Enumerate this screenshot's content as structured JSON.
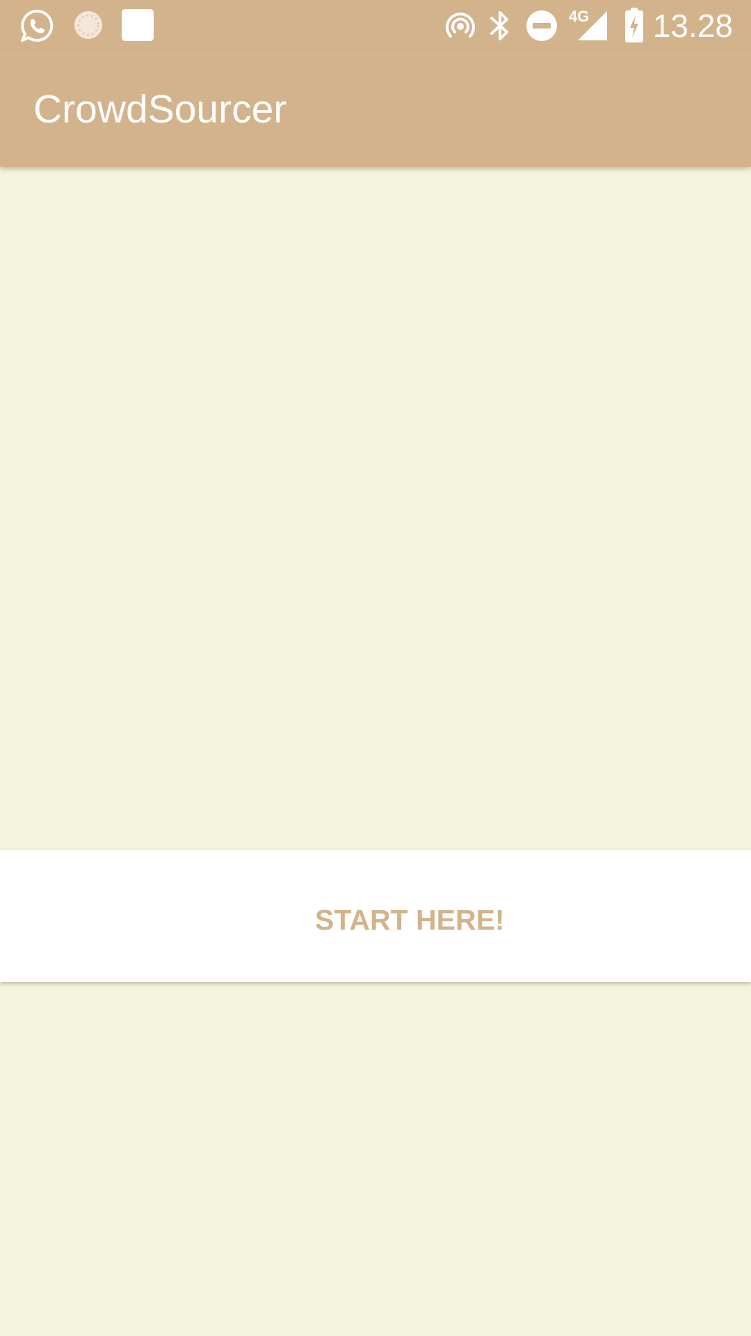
{
  "status_bar": {
    "time": "13.28",
    "left_icons": [
      "whatsapp-icon",
      "sync-spinner-icon",
      "square-notification-icon"
    ],
    "right_icons": [
      "hotspot-icon",
      "bluetooth-icon",
      "do-not-disturb-icon",
      "signal-4g-icon",
      "battery-charging-icon"
    ],
    "network_label": "4G"
  },
  "app_bar": {
    "title": "CrowdSourcer"
  },
  "main": {
    "start_button_label": "START HERE!"
  },
  "colors": {
    "primary": "#D3B38C",
    "background": "#F4F3DC",
    "panel": "#FFFFFF",
    "on_primary": "#FFFFFF"
  }
}
